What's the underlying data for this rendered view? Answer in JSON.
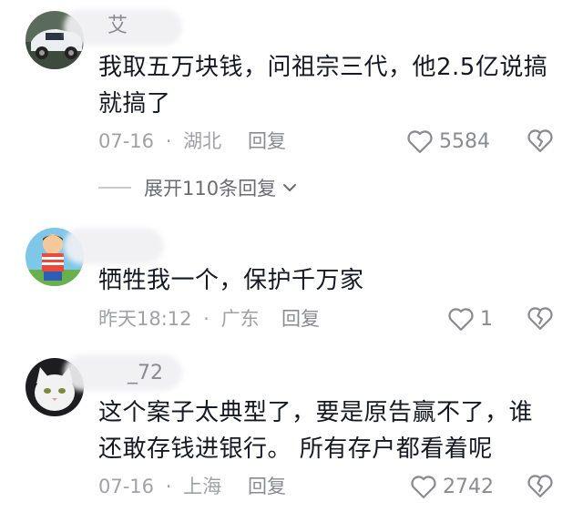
{
  "comments": [
    {
      "username": "艾",
      "text_lines": [
        "我取五万块钱，问祖宗三代，他2.5亿说搞",
        "就搞了"
      ],
      "date": "07-16",
      "location": "湖北",
      "reply_label": "回复",
      "likes": "5584"
    },
    {
      "username": "",
      "text_lines": [
        "牺牲我一个，保护千万家"
      ],
      "date": "昨天18:12",
      "location": "广东",
      "reply_label": "回复",
      "likes": "1"
    },
    {
      "username": "_72",
      "text_lines": [
        "这个案子太典型了，要是原告赢不了，谁",
        "还敢存钱进银行。 所有存户都看着呢"
      ],
      "date": "07-16",
      "location": "上海",
      "reply_label": "回复",
      "likes": "2742"
    }
  ],
  "expand_replies": {
    "label": "展开110条回复"
  },
  "meta_separator": "·",
  "icons": {
    "like": "heart-outline-icon",
    "dislike": "broken-heart-icon",
    "expand": "chevron-down-icon"
  },
  "colors": {
    "text": "#161823",
    "meta": "#a0a1a6",
    "icon": "#8a8b91"
  }
}
